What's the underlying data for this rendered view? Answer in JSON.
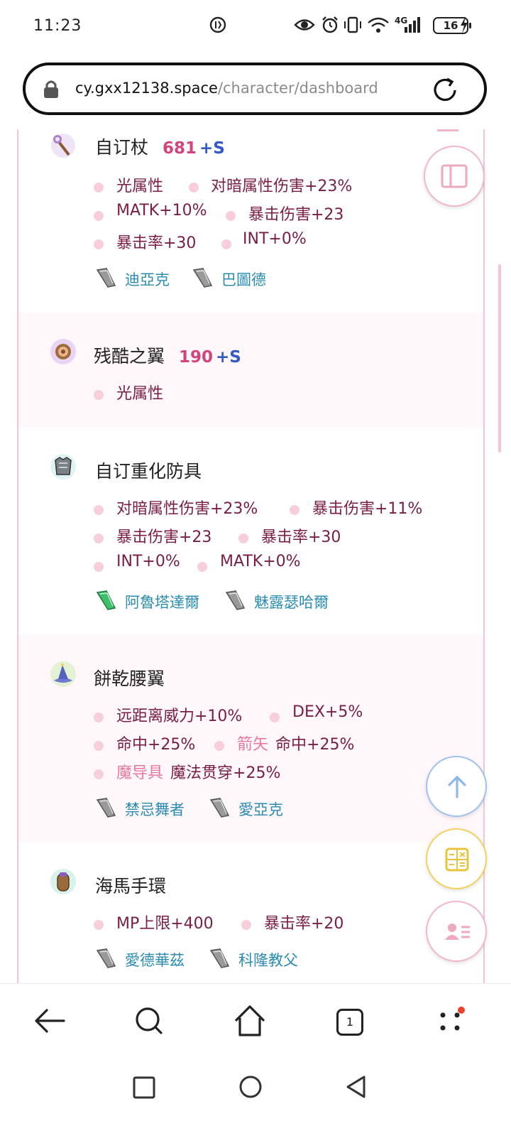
{
  "status_bar": {
    "time": "11:23",
    "network_label": "4G",
    "battery": "16"
  },
  "address_bar": {
    "host": "cy.gxx12138.space",
    "path": "/character/dashboard"
  },
  "equipment": [
    {
      "name": "自订杖",
      "refine": "681",
      "refine_suffix": "+S",
      "icon": "staff-icon",
      "attributes": [
        {
          "prefix": "",
          "text": "光属性"
        },
        {
          "prefix": "",
          "text": "对暗属性伤害+23%"
        },
        {
          "prefix": "",
          "text": "MATK+10%"
        },
        {
          "prefix": "",
          "text": "暴击伤害+23"
        },
        {
          "prefix": "",
          "text": "暴击率+30"
        },
        {
          "prefix": "",
          "text": "INT+0%"
        }
      ],
      "cards": [
        "迪亞克",
        "巴圖德"
      ]
    },
    {
      "name": "残酷之翼",
      "refine": "190",
      "refine_suffix": "+S",
      "icon": "wing-icon",
      "attributes": [
        {
          "prefix": "",
          "text": "光属性"
        }
      ],
      "cards": []
    },
    {
      "name": "自订重化防具",
      "refine": "",
      "refine_suffix": "",
      "icon": "armor-icon",
      "attributes": [
        {
          "prefix": "",
          "text": "对暗属性伤害+23%"
        },
        {
          "prefix": "",
          "text": "暴击伤害+11%"
        },
        {
          "prefix": "",
          "text": "暴击伤害+23"
        },
        {
          "prefix": "",
          "text": "暴击率+30"
        },
        {
          "prefix": "",
          "text": "INT+0%"
        },
        {
          "prefix": "",
          "text": "MATK+0%"
        }
      ],
      "cards": [
        "阿魯塔達爾",
        "魅露瑟哈爾"
      ]
    },
    {
      "name": "餅乾腰翼",
      "refine": "",
      "refine_suffix": "",
      "icon": "hat-icon",
      "attributes": [
        {
          "prefix": "",
          "text": "远距离威力+10%"
        },
        {
          "prefix": "",
          "text": "DEX+5%"
        },
        {
          "prefix": "",
          "text": "命中+25%"
        },
        {
          "prefix": "箭矢",
          "text": "命中+25%"
        },
        {
          "prefix": "魔导具",
          "text": "魔法贯穿+25%"
        }
      ],
      "cards": [
        "禁忌舞者",
        "愛亞克"
      ]
    },
    {
      "name": "海馬手環",
      "refine": "",
      "refine_suffix": "",
      "icon": "bracelet-icon",
      "attributes": [
        {
          "prefix": "",
          "text": "MP上限+400"
        },
        {
          "prefix": "",
          "text": "暴击率+20"
        }
      ],
      "cards": [
        "愛德華茲",
        "科隆教父"
      ]
    }
  ],
  "fab_buttons": [
    "scroll-top",
    "calculator",
    "character-profile"
  ],
  "toolbar": {
    "tab_count": "1"
  },
  "colors": {
    "accent_pink": "#d3447d",
    "refine_blue": "#3159c7",
    "attribute_text": "#7a1d44",
    "card_text": "#2a8cb1",
    "alt_row_bg": "#fff7fa"
  }
}
